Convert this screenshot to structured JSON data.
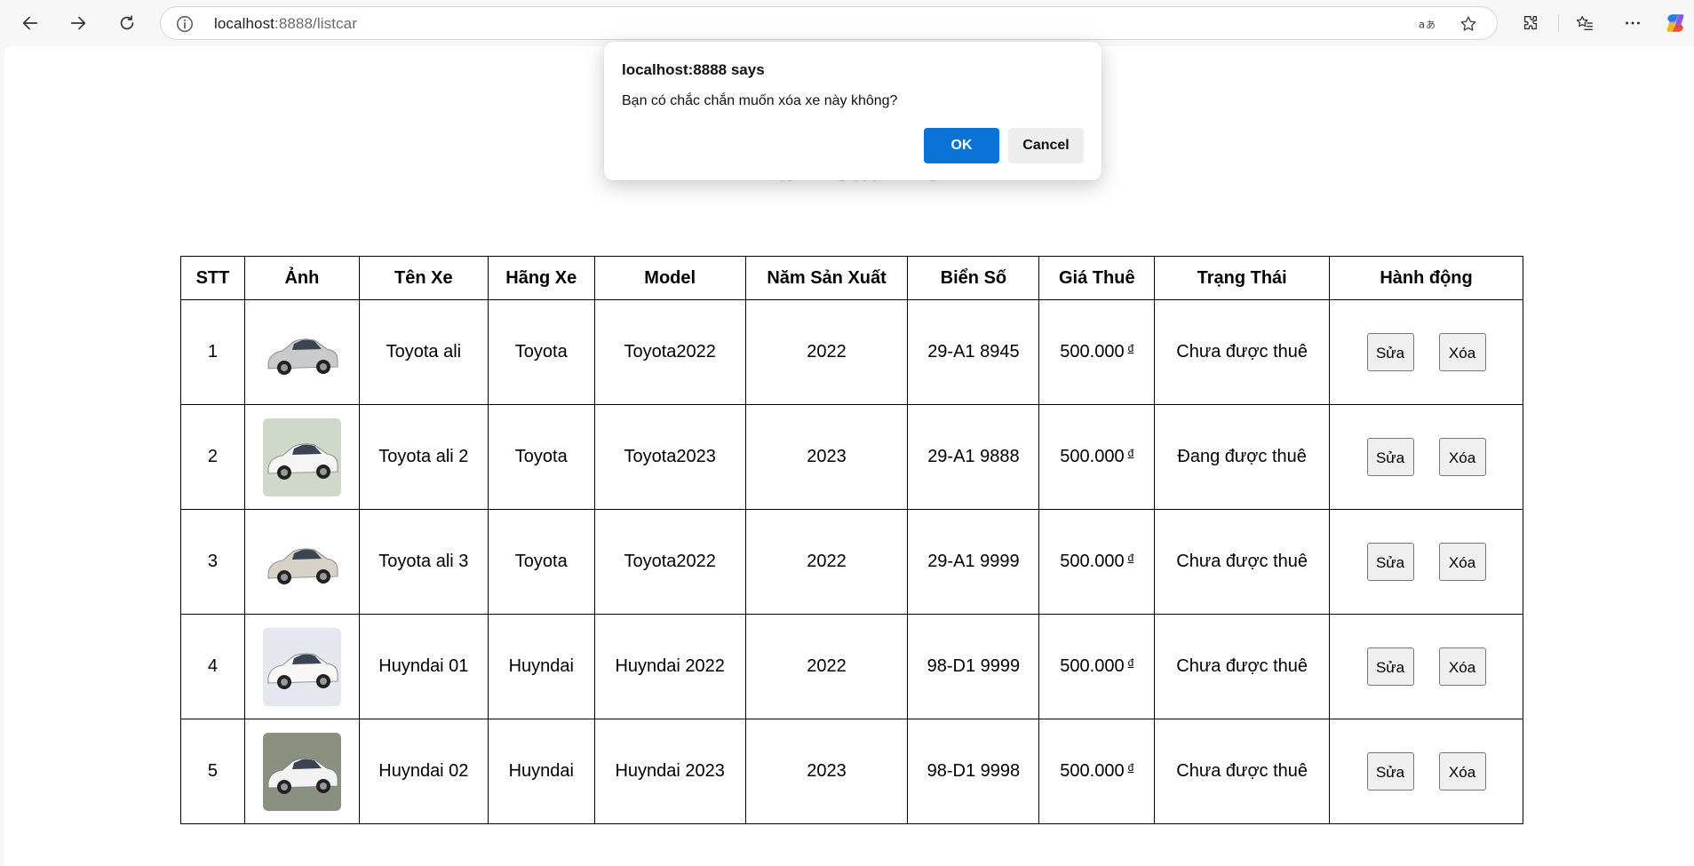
{
  "browser": {
    "url_host": "localhost",
    "url_rest": ":8888/listcar"
  },
  "dialog": {
    "title": "localhost:8888 says",
    "message": "Bạn có chắc chắn muốn xóa xe này không?",
    "ok_label": "OK",
    "cancel_label": "Cancel",
    "ok_color": "#0b73d6"
  },
  "page": {
    "title": "Danh Sách Xe"
  },
  "table": {
    "headers": [
      "STT",
      "Ảnh",
      "Tên Xe",
      "Hãng Xe",
      "Model",
      "Năm Sản Xuất",
      "Biển Số",
      "Giá Thuê",
      "Trạng Thái",
      "Hành động"
    ],
    "edit_label": "Sửa",
    "delete_label": "Xóa",
    "currency": "đ",
    "rows": [
      {
        "stt": "1",
        "name": "Toyota ali",
        "brand": "Toyota",
        "model": "Toyota2022",
        "year": "2022",
        "plate": "29-A1 8945",
        "price": "500.000",
        "status": "Chưa được thuê"
      },
      {
        "stt": "2",
        "name": "Toyota ali 2",
        "brand": "Toyota",
        "model": "Toyota2023",
        "year": "2023",
        "plate": "29-A1 9888",
        "price": "500.000",
        "status": "Đang được thuê"
      },
      {
        "stt": "3",
        "name": "Toyota ali 3",
        "brand": "Toyota",
        "model": "Toyota2022",
        "year": "2022",
        "plate": "29-A1 9999",
        "price": "500.000",
        "status": "Chưa được thuê"
      },
      {
        "stt": "4",
        "name": "Huyndai 01",
        "brand": "Huyndai",
        "model": "Huyndai 2022",
        "year": "2022",
        "plate": "98-D1 9999",
        "price": "500.000",
        "status": "Chưa được thuê"
      },
      {
        "stt": "5",
        "name": "Huyndai 02",
        "brand": "Huyndai",
        "model": "Huyndai 2023",
        "year": "2023",
        "plate": "98-D1 9998",
        "price": "500.000",
        "status": "Chưa được thuê"
      }
    ]
  }
}
